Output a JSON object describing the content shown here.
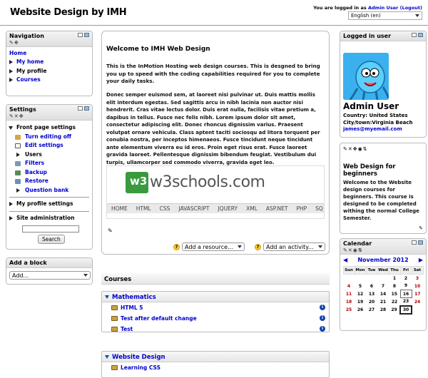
{
  "header": {
    "site_title": "Website Design by IMH",
    "login_prefix": "You are logged in as",
    "login_user": "Admin User",
    "logout_label": "(Logout)",
    "language": "English (en)"
  },
  "navigation": {
    "title": "Navigation",
    "home": "Home",
    "items": [
      "My home",
      "My profile",
      "Courses"
    ]
  },
  "settings": {
    "title": "Settings",
    "front_page_settings": "Front page settings",
    "sub_items": [
      "Turn editing off",
      "Edit settings",
      "Users",
      "Filters",
      "Backup",
      "Restore",
      "Question bank"
    ],
    "my_profile_settings": "My profile settings",
    "site_administration": "Site administration",
    "search_value": "",
    "search_button": "Search"
  },
  "add_block": {
    "title": "Add a block",
    "select_value": "Add..."
  },
  "main": {
    "welcome_title": "Welcome to IMH Web Design",
    "intro": "This is the InMotion Hosting web design courses. This is desgned to bring you up to speed with the coding capabilities required for you to complete your daily tasks.",
    "lorem": "Donec semper euismod sem, at laoreet nisi pulvinar ut. Duis mattis mollis elit interdum egestas. Sed sagittis arcu in nibh lacinia non auctor nisi hendrerit. Cras vitae lectus dolor. Duis erat nulla, facilisis vitae pretium a, dapibus in tellus. Fusce nec felis nibh. Lorem ipsum dolor sit amet, consectetur adipiscing elit. Donec rhoncus dignissim varius. Praesent volutpat ornare vehicula. Class aptent taciti sociosqu ad litora torquent per conubia nostra, per inceptos himenaeos. Fusce tincidunt neque tincidunt ante elementum viverra eu id eros. Proin eget risus erat. Fusce laoreet gravida laoreet. Pellentesque dignissim bibendum feugiat. Vestibulum dui turpis, ullamcorper sed commodo viverra, gravida eget leo.",
    "w3_logo_letter": "w3",
    "w3_word": "w3schools.com",
    "w3_nav": [
      "HOME",
      "HTML",
      "CSS",
      "JAVASCRIPT",
      "JQUERY",
      "XML",
      "ASP.NET",
      "PHP",
      "SQ"
    ],
    "add_resource": "Add a resource...",
    "add_activity": "Add an activity..."
  },
  "courses": {
    "title": "Courses",
    "categories": [
      {
        "name": "Mathematics",
        "courses": [
          "HTML 5",
          "Test after default change",
          "Test"
        ]
      },
      {
        "name": "Website Design",
        "courses": [
          "Learning CSS"
        ]
      }
    ]
  },
  "logged_in_user": {
    "title": "Logged in user",
    "name": "Admin User",
    "country_label": "Country:",
    "country": "United States",
    "city_label": "City/town:",
    "city": "Virginia Beach",
    "email": "james@myemail.com"
  },
  "html_block": {
    "title": "Web Design for beginners",
    "body": "Welcome to the Website design courses for beginners. This course is designed to be completed withing the normal College Semester."
  },
  "calendar": {
    "title": "Calendar",
    "month": "November 2012",
    "weekdays": [
      "Sun",
      "Mon",
      "Tue",
      "Wed",
      "Thu",
      "Fri",
      "Sat"
    ],
    "weeks": [
      [
        "",
        "",
        "",
        "",
        "1",
        "2",
        "3"
      ],
      [
        "4",
        "5",
        "6",
        "7",
        "8",
        "9",
        "10"
      ],
      [
        "11",
        "12",
        "13",
        "14",
        "15",
        "16",
        "17"
      ],
      [
        "18",
        "19",
        "20",
        "21",
        "22",
        "23",
        "24"
      ],
      [
        "25",
        "26",
        "27",
        "28",
        "29",
        "30",
        ""
      ]
    ],
    "today": "30",
    "event_day": "16"
  },
  "colors": {
    "link": "#0000cc",
    "calendar_month": "#0000cc",
    "avatar_bg": "#3ab0ee"
  }
}
